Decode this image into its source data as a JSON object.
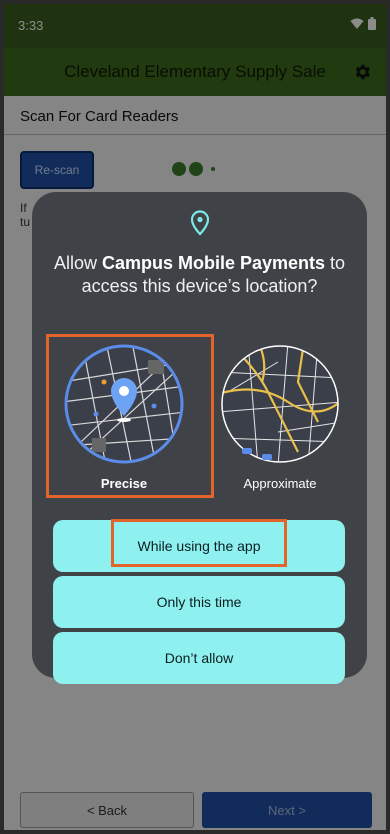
{
  "status_bar": {
    "time": "3:33"
  },
  "app_bar": {
    "title": "Cleveland Elementary Supply Sale"
  },
  "content": {
    "section_title": "Scan For Card Readers",
    "rescan_label": "Re-scan",
    "partial_text_line1": "If",
    "partial_text_line2": "tu"
  },
  "footer": {
    "back_label": "< Back",
    "next_label": "Next >"
  },
  "dialog": {
    "message_prefix": "Allow ",
    "app_name": "Campus Mobile Payments",
    "message_suffix": " to access this device’s location?",
    "option_precise": "Precise",
    "option_approximate": "Approximate",
    "buttons": {
      "while_using": "While using the app",
      "only_this_time": "Only this time",
      "dont_allow": "Don’t allow"
    }
  },
  "colors": {
    "app_bar": "#3d6a1c",
    "primary_button": "#1f4fa6",
    "dialog_bg": "#3f4246",
    "dialog_button": "#8ff0f0",
    "highlight": "#e2642a"
  },
  "icons": [
    "wifi-icon",
    "battery-icon",
    "gear-icon",
    "location-pin-icon"
  ]
}
